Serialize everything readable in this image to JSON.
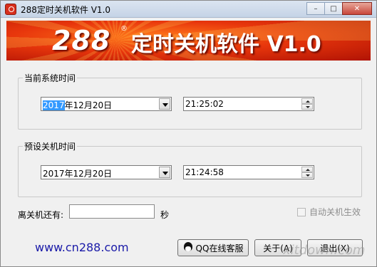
{
  "window": {
    "title": "288定时关机软件 V1.0",
    "minimize_glyph": "–",
    "maximize_glyph": "□",
    "close_glyph": "✕"
  },
  "banner": {
    "logo": "288",
    "registered": "®",
    "title": "定时关机软件 V1.0"
  },
  "current_time": {
    "legend": "当前系统时间",
    "date_selected": "2017",
    "date_rest": "年12月20日",
    "time": "21:25:02"
  },
  "shutdown_time": {
    "legend": "预设关机时间",
    "date": "2017年12月20日",
    "time": "21:24:58"
  },
  "remaining": {
    "label": "离关机还有:",
    "value": "",
    "unit": "秒"
  },
  "auto_shutdown": {
    "label": "自动关机生效",
    "checked": false
  },
  "footer": {
    "website": "www.cn288.com",
    "qq_button": "QQ在线客服",
    "about_button": "关于(A)",
    "exit_button": "退出(X)",
    "watermark": "xitdown.com"
  },
  "colors": {
    "banner_red": "#e8360c",
    "link_blue": "#1a1aa8",
    "selection_blue": "#3399ff"
  },
  "icons": {
    "app": "app-clock-icon",
    "qq": "qq-penguin-icon",
    "combo_arrow": "chevron-down-icon",
    "spin": "spin-arrows-icon"
  }
}
